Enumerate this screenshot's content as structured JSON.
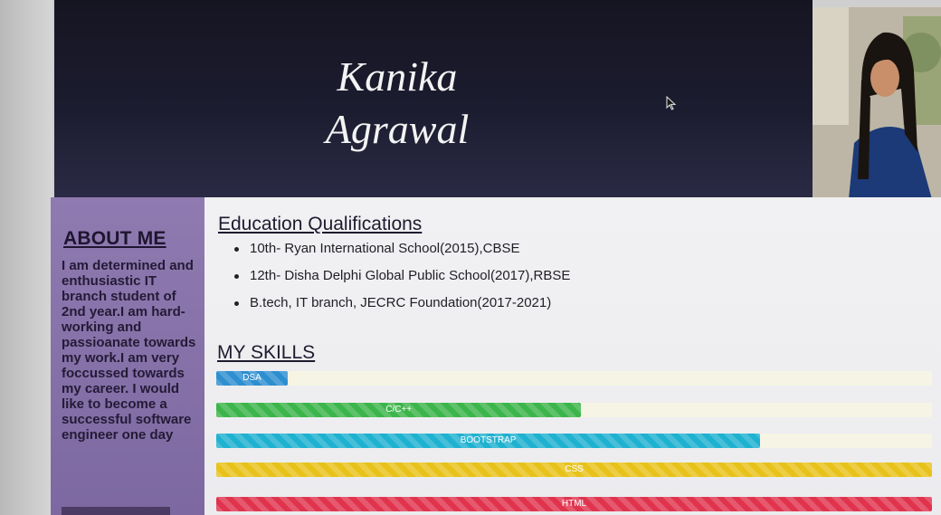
{
  "header": {
    "name_line1": "Kanika",
    "name_line2": "Agrawal"
  },
  "about": {
    "title": "ABOUT ME",
    "text": "I am determined and enthusiastic IT branch student of 2nd year.I am hard-working and passioanate towards my work.I am very foccussed towards my career. I would like to become a successful software engineer one day"
  },
  "education": {
    "title": "Education Qualifications",
    "items": [
      "10th- Ryan International School(2015),CBSE",
      "12th- Disha Delphi Global Public School(2017),RBSE",
      "B.tech, IT branch, JECRC Foundation(2017-2021)"
    ]
  },
  "skills": {
    "title": "MY SKILLS",
    "items": [
      {
        "label": "DSA",
        "level": 0.1,
        "color": "#2e8fd0"
      },
      {
        "label": "C/C++",
        "level": 0.51,
        "color": "#3cb54a"
      },
      {
        "label": "BOOTSTRAP",
        "level": 0.76,
        "color": "#1fb1d0"
      },
      {
        "label": "CSS",
        "level": 1.0,
        "color": "#e8c21a"
      },
      {
        "label": "HTML",
        "level": 1.0,
        "color": "#e0344e"
      }
    ]
  },
  "photo": {
    "alt": "profile photo"
  }
}
